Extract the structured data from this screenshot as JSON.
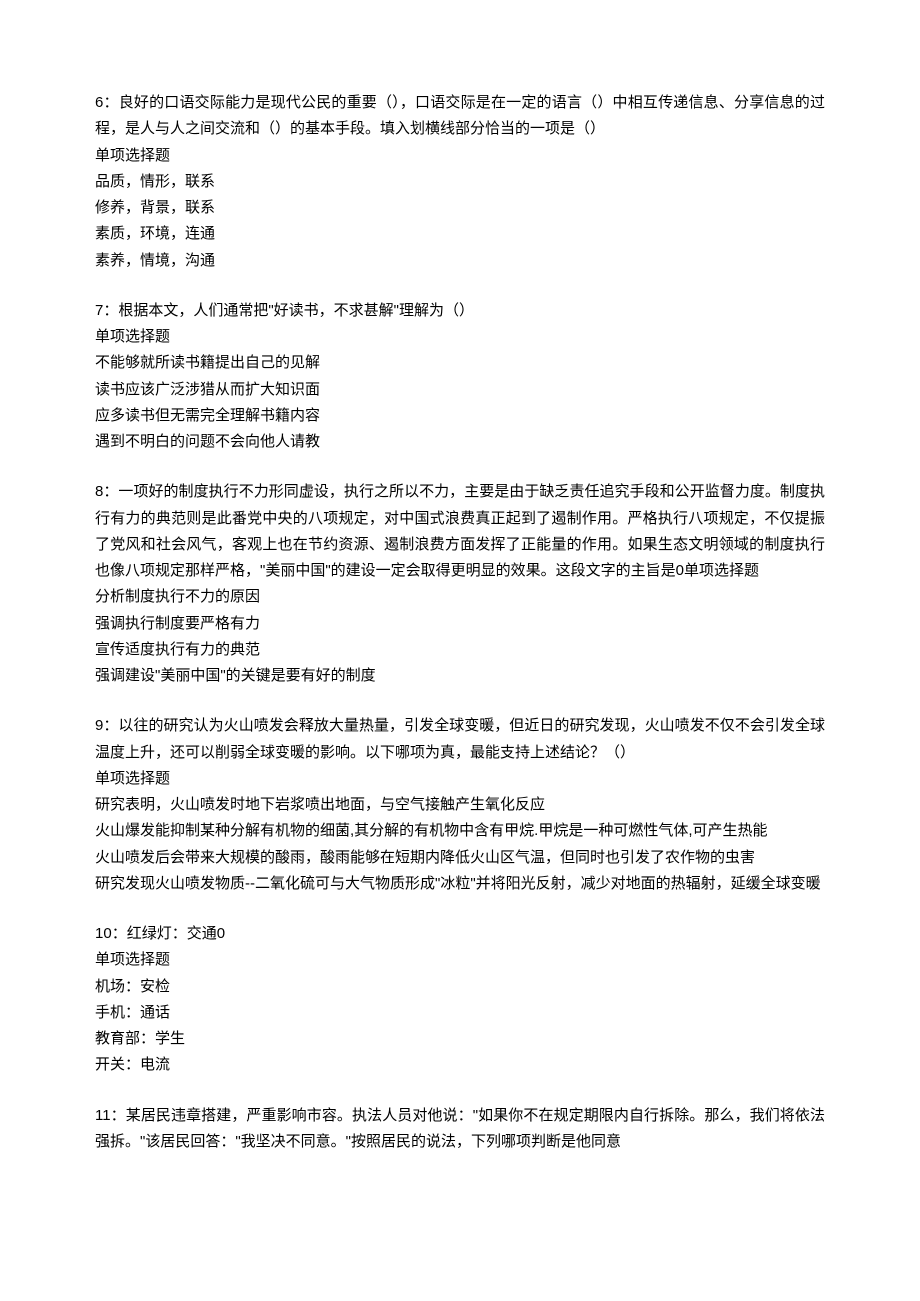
{
  "questions": [
    {
      "number": "6",
      "stem": "良好的口语交际能力是现代公民的重要（），口语交际是在一定的语言（）中相互传递信息、分享信息的过程，是人与人之间交流和（）的基本手段。填入划横线部分恰当的一项是（）",
      "type": "单项选择题",
      "options": [
        "品质，情形，联系",
        "修养，背景，联系",
        "素质，环境，连通",
        "素养，情境，沟通"
      ]
    },
    {
      "number": "7",
      "stem": "根据本文，人们通常把\"好读书，不求甚解\"理解为（）",
      "type": "单项选择题",
      "options": [
        "不能够就所读书籍提出自己的见解",
        "读书应该广泛涉猎从而扩大知识面",
        "应多读书但无需完全理解书籍内容",
        "遇到不明白的问题不会向他人请教"
      ]
    },
    {
      "number": "8",
      "stem": "一项好的制度执行不力形同虚设，执行之所以不力，主要是由于缺乏责任追究手段和公开监督力度。制度执行有力的典范则是此番党中央的八项规定，对中国式浪费真正起到了遏制作用。严格执行八项规定，不仅提振了党风和社会风气，客观上也在节约资源、遏制浪费方面发挥了正能量的作用。如果生态文明领域的制度执行也像八项规定那样严格，\"美丽中国\"的建设一定会取得更明显的效果。这段文字的主旨是0单项选择题",
      "type": "",
      "options": [
        "分析制度执行不力的原因",
        "强调执行制度要严格有力",
        "宣传适度执行有力的典范",
        "强调建设\"美丽中国\"的关键是要有好的制度"
      ]
    },
    {
      "number": "9",
      "stem": "以往的研究认为火山喷发会释放大量热量，引发全球变暖，但近日的研究发现，火山喷发不仅不会引发全球温度上升，还可以削弱全球变暖的影响。以下哪项为真，最能支持上述结论？（）",
      "type": "单项选择题",
      "options": [
        "研究表明，火山喷发时地下岩浆喷出地面，与空气接触产生氧化反应",
        "火山爆发能抑制某种分解有机物的细菌,其分解的有机物中含有甲烷.甲烷是一种可燃性气体,可产生热能",
        "火山喷发后会带来大规模的酸雨，酸雨能够在短期内降低火山区气温，但同时也引发了农作物的虫害",
        "研究发现火山喷发物质--二氧化硫可与大气物质形成\"冰粒\"并将阳光反射，减少对地面的热辐射，延缓全球变暖"
      ]
    },
    {
      "number": "10",
      "stem": "红绿灯：交通0",
      "type": "单项选择题",
      "options": [
        "机场：安检",
        "手机：通话",
        "教育部：学生",
        "开关：电流"
      ]
    },
    {
      "number": "11",
      "stem": "某居民违章搭建，严重影响市容。执法人员对他说：\"如果你不在规定期限内自行拆除。那么，我们将依法强拆。\"该居民回答：\"我坚决不同意。\"按照居民的说法，下列哪项判断是他同意",
      "type": "",
      "options": []
    }
  ]
}
